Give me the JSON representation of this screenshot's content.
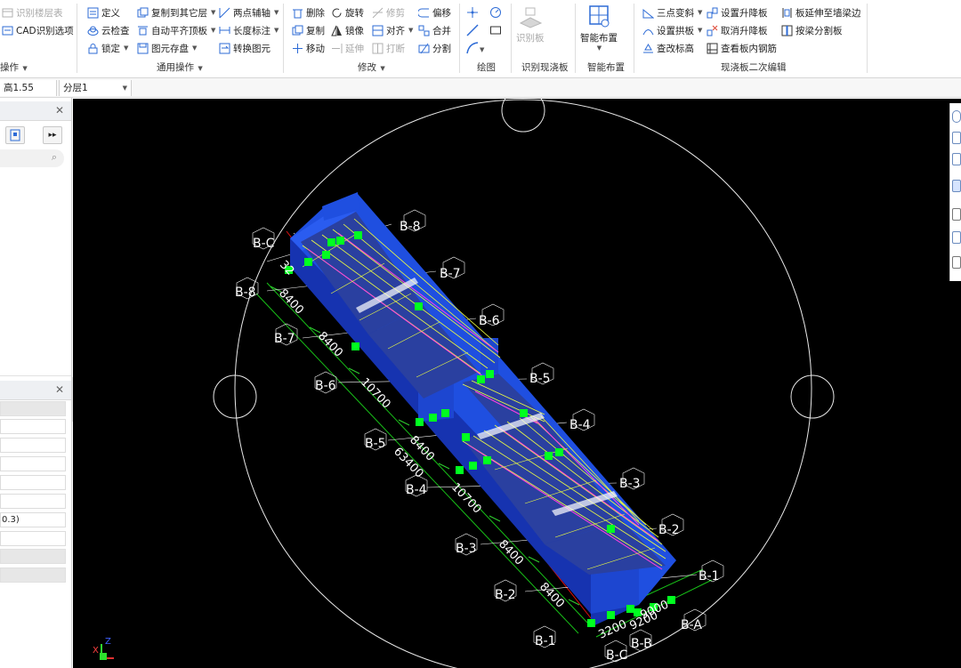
{
  "ribbon": {
    "col1": {
      "items": [
        "识别楼层表",
        "CAD识别选项"
      ],
      "group": "操作"
    },
    "col2": {
      "items": [
        "定义",
        "云检查",
        "锁定"
      ]
    },
    "col3": {
      "items": [
        "复制到其它层",
        "自动平齐顶板",
        "图元存盘"
      ]
    },
    "col4": {
      "items": [
        "两点辅轴",
        "长度标注",
        "转换图元"
      ]
    },
    "group_general": "通用操作",
    "col5": {
      "items": [
        "删除",
        "复制",
        "移动"
      ]
    },
    "col6": {
      "items": [
        "旋转",
        "镜像",
        "延伸"
      ]
    },
    "col7": {
      "items": [
        "修剪",
        "对齐",
        "打断"
      ]
    },
    "col8": {
      "items": [
        "偏移",
        "合并",
        "分割"
      ]
    },
    "group_modify": "修改",
    "group_draw": "绘图",
    "recognize_btn": "识别板",
    "group_recognize": "识别现浇板",
    "smart_btn": "智能布置",
    "group_smart": "智能布置",
    "col9": {
      "items": [
        "三点变斜",
        "设置拱板",
        "查改标高"
      ]
    },
    "col10": {
      "items": [
        "设置升降板",
        "取消升降板",
        "查看板内钢筋"
      ]
    },
    "col11": {
      "items": [
        "板延伸至墙梁边",
        "按梁分割板"
      ]
    },
    "group_edit2": "现浇板二次编辑"
  },
  "formbar": {
    "elevation": "高1.55",
    "layer": "分层1"
  },
  "leftpanel": {
    "value": "0.3)"
  },
  "viewport": {
    "axis_labels": [
      "B-C",
      "B-8",
      "B-7",
      "B-6",
      "B-5",
      "B-4",
      "B-3",
      "B-2",
      "B-1",
      "B-A",
      "B-B",
      "B-C"
    ],
    "top_axes": [
      "B-8",
      "B-7",
      "B-6",
      "B-5",
      "B-4",
      "B-3",
      "B-2",
      "B-1",
      "B-A"
    ],
    "left_axes": [
      "B-C",
      "B-8",
      "B-7",
      "B-6",
      "B-5",
      "B-4",
      "B-3",
      "B-2",
      "B-1",
      "B-C",
      "B-B"
    ],
    "spans": [
      "8400",
      "8400",
      "10700",
      "8400",
      "10700",
      "8400",
      "8400"
    ],
    "total_span": "63400",
    "end_spans": [
      "3200",
      "9200",
      "9000"
    ],
    "left_dim": "32",
    "coord_x": "X",
    "coord_z": "Z",
    "colors": {
      "slab": "#1f4fe0",
      "slab_dark": "#1633b0",
      "rebar_yellow": "#f0ff40",
      "rebar_pink": "#ff40e0",
      "marker": "#00ff20",
      "grid": "#ffffff",
      "dim_line": "#18c018"
    }
  }
}
